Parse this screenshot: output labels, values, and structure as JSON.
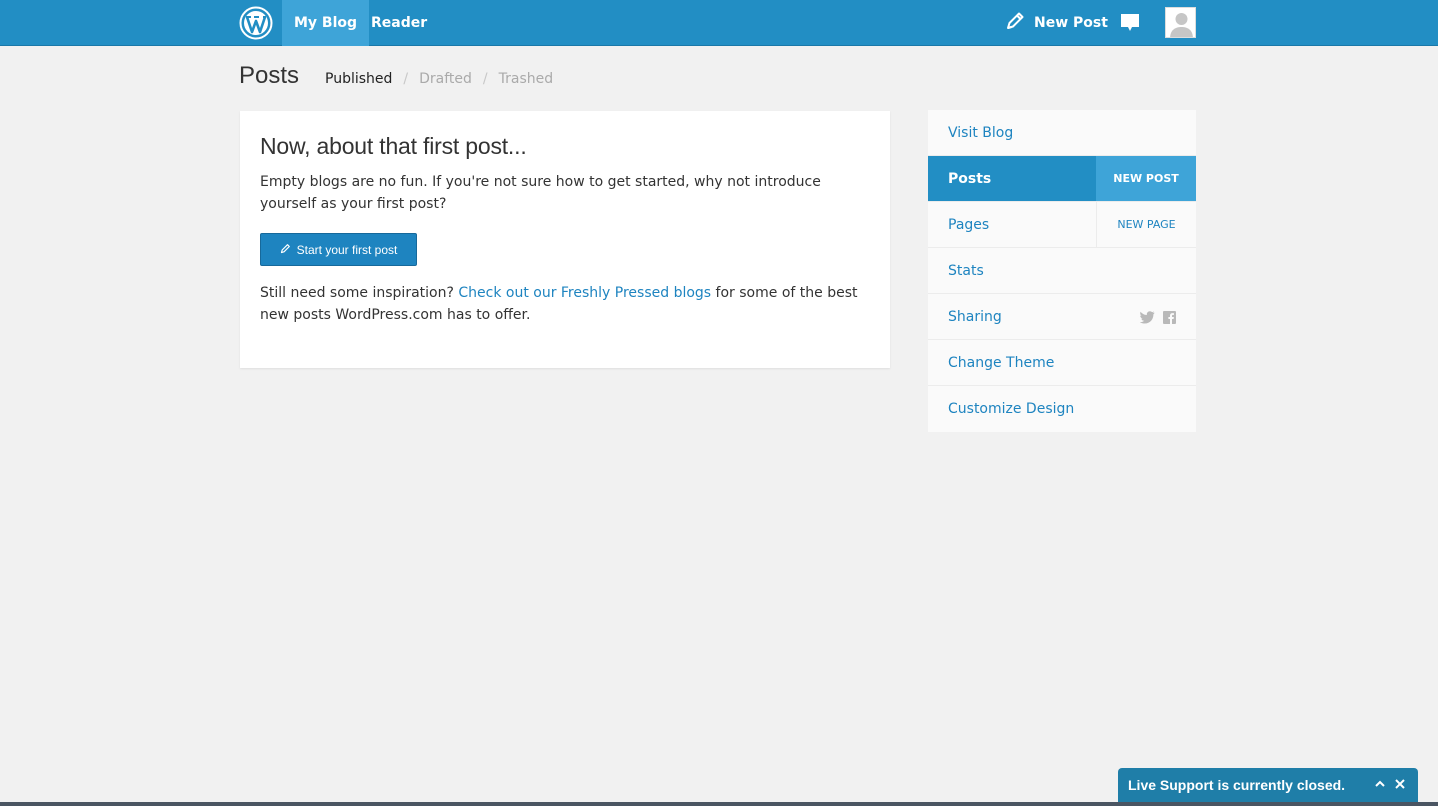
{
  "topbar": {
    "tabs": [
      {
        "label": "My Blog",
        "active": true
      },
      {
        "label": "Reader",
        "active": false
      }
    ],
    "new_post_label": "New Post",
    "colors": {
      "bar": "#228ec4",
      "active_tab": "#3ea4d8"
    }
  },
  "header": {
    "title": "Posts",
    "filters": [
      {
        "label": "Published",
        "active": true
      },
      {
        "label": "Drafted",
        "active": false
      },
      {
        "label": "Trashed",
        "active": false
      }
    ],
    "separator": "/"
  },
  "card": {
    "heading": "Now, about that first post...",
    "text": "Empty blogs are no fun. If you're not sure how to get started, why not introduce yourself as your first post?",
    "button_label": "Start your first post",
    "inspire_before": "Still need some inspiration? ",
    "inspire_link": "Check out our Freshly Pressed blogs",
    "inspire_after": " for some of the best new posts WordPress.com has to offer."
  },
  "sidebar": {
    "items": [
      {
        "label": "Visit Blog",
        "action": ""
      },
      {
        "label": "Posts",
        "action": "NEW POST",
        "active": true
      },
      {
        "label": "Pages",
        "action": "NEW PAGE"
      },
      {
        "label": "Stats",
        "action": ""
      },
      {
        "label": "Sharing",
        "action": "",
        "icons": [
          "twitter-icon",
          "facebook-icon"
        ]
      },
      {
        "label": "Change Theme",
        "action": ""
      },
      {
        "label": "Customize Design",
        "action": ""
      }
    ]
  },
  "live_support": {
    "label": "Live Support is currently closed."
  }
}
